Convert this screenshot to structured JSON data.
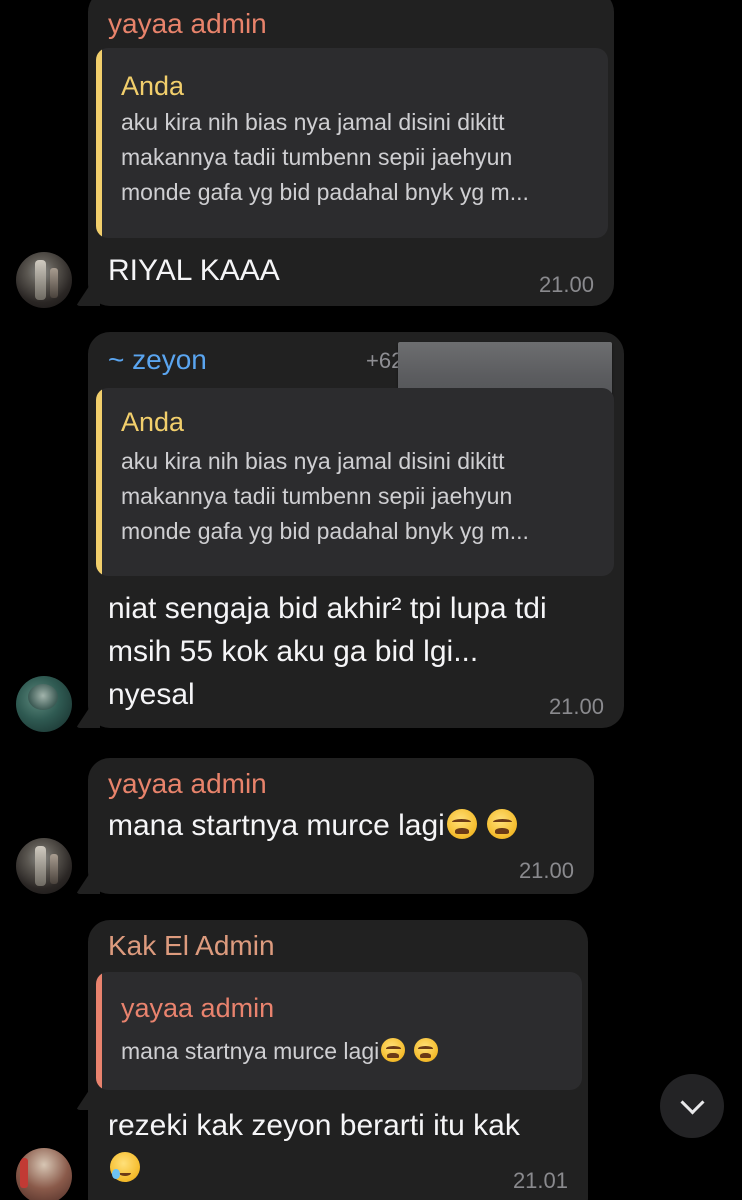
{
  "messages": [
    {
      "sender": "yayaa admin",
      "reply": {
        "name": "Anda",
        "text": "aku kira nih bias nya jamal disini dikitt\nmakannya tadii tumbenn sepii jaehyun\nmonde gafa yg bid padahal bnyk yg m..."
      },
      "text": "RIYAL KAAA",
      "time": "21.00"
    },
    {
      "sender": "~ zeyon",
      "phone": "+62",
      "reply": {
        "name": "Anda",
        "text": "aku kira nih bias nya jamal disini dikitt\nmakannya tadii tumbenn sepii jaehyun\nmonde gafa yg bid padahal bnyk yg m..."
      },
      "text": "niat sengaja bid akhir² tpi lupa tdi\nmsih 55 kok aku ga bid lgi...\nnyesal",
      "time": "21.00"
    },
    {
      "sender": "yayaa admin",
      "text": "mana startnya murce lagi",
      "emoji": [
        "weary-face-emoji",
        "weary-face-emoji"
      ],
      "time": "21.00"
    },
    {
      "sender": "Kak El Admin",
      "reply": {
        "name": "yayaa admin",
        "text": "mana startnya murce lagi",
        "emoji": [
          "weary-face-emoji",
          "weary-face-emoji"
        ]
      },
      "text": "rezeki kak zeyon berarti itu kak",
      "emoji": [
        "face-holding-back-tears-emoji"
      ],
      "time": "21.01"
    }
  ],
  "colors": {
    "background": "#000000",
    "bubble": "#212121",
    "quote_background": "#2c2c2e",
    "sender_yayaa": "#e8836b",
    "sender_kakel": "#dd9b7e",
    "sender_zeyon": "#5aa5f0",
    "quote_yellow": "#f2cf6c",
    "quote_salmon": "#e9836e",
    "timestamp": "#8a8a8e"
  },
  "icons": {
    "scroll_down": "chevron-down-icon"
  }
}
